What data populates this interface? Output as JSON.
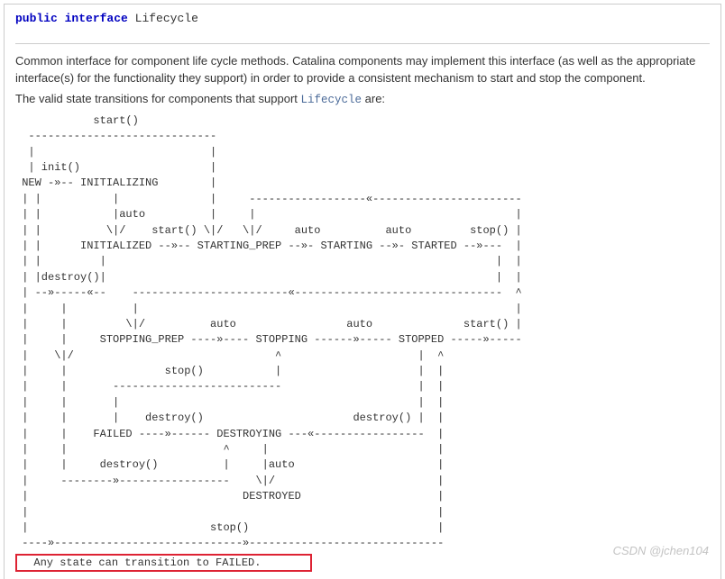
{
  "signature": {
    "modifier1": "public",
    "modifier2": "interface",
    "name": "Lifecycle"
  },
  "description": {
    "line1": "Common interface for component life cycle methods. Catalina components may implement this interface (as well as the appropriate interface(s) for the functionality they support) in order to provide a consistent mechanism to start and stop the component.",
    "line2_prefix": "The valid state transitions for components that support ",
    "line2_link": "Lifecycle",
    "line2_suffix": " are:"
  },
  "diagram_lines": [
    "            start()",
    "  -----------------------------",
    "  |                           |",
    "  | init()                    |",
    " NEW -»-- INITIALIZING        |",
    " | |           |              |     ------------------«-----------------------",
    " | |           |auto          |     |                                        |",
    " | |          \\|/    start() \\|/   \\|/     auto          auto         stop() |",
    " | |      INITIALIZED --»-- STARTING_PREP --»- STARTING --»- STARTED --»---  |",
    " | |         |                                                            |  |",
    " | |destroy()|                                                            |  |",
    " | --»-----«--    ------------------------«--------------------------------  ^",
    " |     |          |                                                          |",
    " |     |         \\|/          auto                 auto              start() |",
    " |     |     STOPPING_PREP ----»---- STOPPING ------»----- STOPPED -----»-----",
    " |    \\|/                               ^                     |  ^",
    " |     |               stop()           |                     |  |",
    " |     |       --------------------------                     |  |",
    " |     |       |                                              |  |",
    " |     |       |    destroy()                       destroy() |  |",
    " |     |    FAILED ----»------ DESTROYING ---«-----------------  |",
    " |     |                        ^     |                          |",
    " |     |     destroy()          |     |auto                      |",
    " |     --------»-----------------    \\|/                         |",
    " |                                 DESTROYED                     |",
    " |                                                               |",
    " |                            stop()                             |",
    " ----»-----------------------------»------------------------------"
  ],
  "highlight": "  Any state can transition to FAILED.       ",
  "watermark": "CSDN @jchen104"
}
